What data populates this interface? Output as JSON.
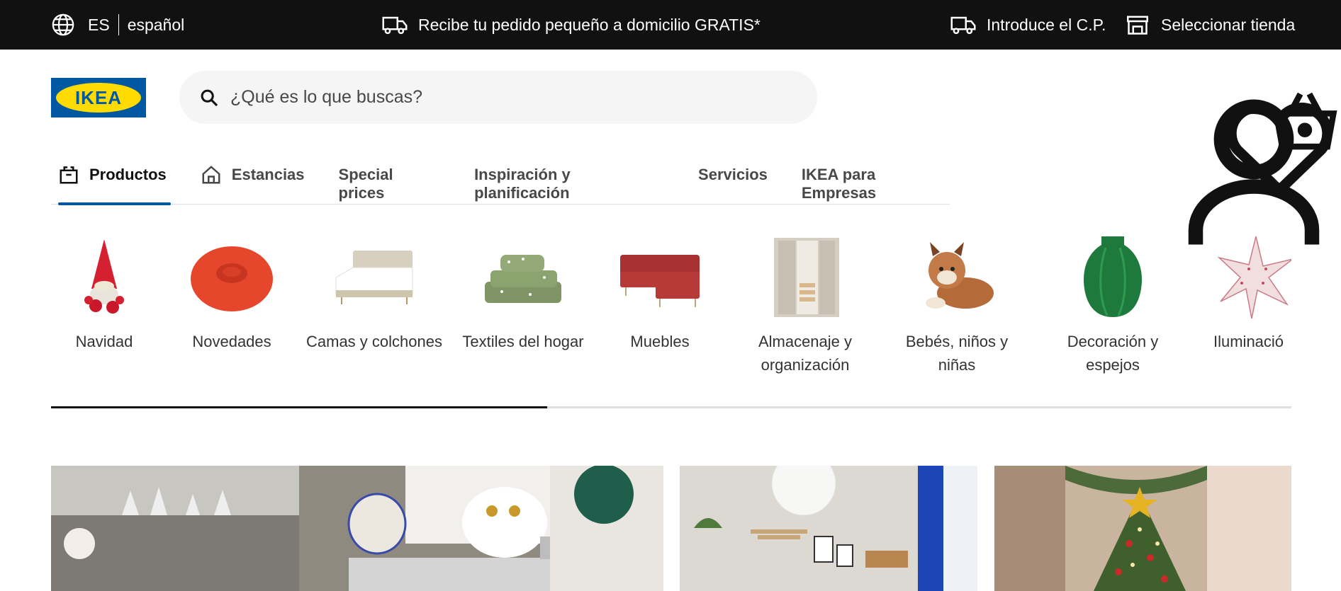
{
  "topbar": {
    "lang_code": "ES",
    "lang_name": "español",
    "promo": "Recibe tu pedido pequeño a domicilio GRATIS*",
    "postal_code": "Introduce el C.P.",
    "store": "Seleccionar tienda"
  },
  "header": {
    "logo_text": "IKEA",
    "search_placeholder": "¿Qué es lo que buscas?"
  },
  "tabs": [
    {
      "label": "Productos",
      "active": true,
      "icon": "box-icon"
    },
    {
      "label": "Estancias",
      "active": false,
      "icon": "home-icon"
    },
    {
      "label": "Special prices",
      "active": false
    },
    {
      "label": "Inspiración y planificación",
      "active": false
    },
    {
      "label": "Servicios",
      "active": false
    },
    {
      "label": "IKEA para Empresas",
      "active": false
    }
  ],
  "categories": [
    {
      "line1": "Navidad",
      "line2": "",
      "icon": "gnome-icon"
    },
    {
      "line1": "Novedades",
      "line2": "",
      "icon": "beanbag-icon"
    },
    {
      "line1": "Camas y colchones",
      "line2": "",
      "icon": "bed-icon"
    },
    {
      "line1": "Textiles del hogar",
      "line2": "",
      "icon": "pillows-icon"
    },
    {
      "line1": "Muebles",
      "line2": "",
      "icon": "sofa-icon"
    },
    {
      "line1": "Almacenaje y",
      "line2": "organización",
      "icon": "wardrobe-icon"
    },
    {
      "line1": "Bebés, niños y",
      "line2": "niñas",
      "icon": "lynx-toy-icon"
    },
    {
      "line1": "Decoración y",
      "line2": "espejos",
      "icon": "vase-icon"
    },
    {
      "line1": "Iluminació",
      "line2": "",
      "icon": "star-lamp-icon"
    }
  ],
  "scroll_progress": 0.4,
  "colors": {
    "topbar": "#111111",
    "brand_blue": "#0058a3",
    "brand_yellow": "#ffdb00"
  }
}
